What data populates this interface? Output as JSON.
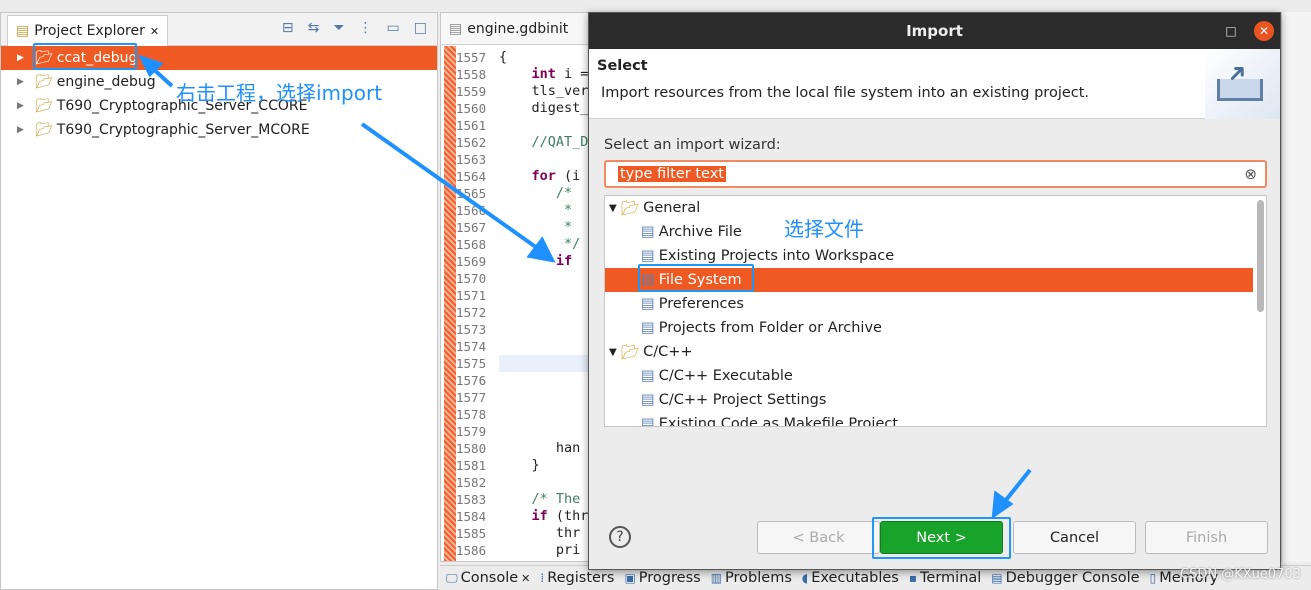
{
  "project_explorer": {
    "tab_label": "Project Explorer",
    "items": [
      {
        "label": "ccat_debug",
        "selected": true
      },
      {
        "label": "engine_debug"
      },
      {
        "label": "T690_Cryptographic_Server_CCORE"
      },
      {
        "label": "T690_Cryptographic_Server_MCORE"
      }
    ]
  },
  "editor": {
    "tab_label": "engine.gdbinit",
    "line_numbers": [
      "1557",
      "1558",
      "1559",
      "1560",
      "1561",
      "1562",
      "1563",
      "1564",
      "1565",
      "1566",
      "1567",
      "1568",
      "1569",
      "1570",
      "1571",
      "1572",
      "1573",
      "1574",
      "1575",
      "1576",
      "1577",
      "1578",
      "1579",
      "1580",
      "1581",
      "1582",
      "1583",
      "1584",
      "1585",
      "1586"
    ],
    "code": [
      "{",
      "    int i =",
      "    tls_ver",
      "    digest_",
      "",
      "    //QAT_D",
      "",
      "    for (i",
      "       /*",
      "        *",
      "        *",
      "        */",
      "       if",
      "",
      "",
      "",
      "",
      "",
      "",
      "",
      "",
      "",
      "",
      "       han",
      "    }",
      "",
      "    /* The",
      "    if (thr",
      "       thr",
      "       pri"
    ]
  },
  "bottom_tabs": [
    "Console",
    "Registers",
    "Progress",
    "Problems",
    "Executables",
    "Terminal",
    "Debugger Console",
    "Memory"
  ],
  "dialog": {
    "title": "Import",
    "header_title": "Select",
    "header_desc": "Import resources from the local file system into an existing project.",
    "wizard_label": "Select an import wizard:",
    "filter_value": "type filter text",
    "tree": [
      {
        "label": "General",
        "level": 0
      },
      {
        "label": "Archive File",
        "level": 1
      },
      {
        "label": "Existing Projects into Workspace",
        "level": 1
      },
      {
        "label": "File System",
        "level": 1,
        "selected": true
      },
      {
        "label": "Preferences",
        "level": 1
      },
      {
        "label": "Projects from Folder or Archive",
        "level": 1
      },
      {
        "label": "C/C++",
        "level": 0
      },
      {
        "label": "C/C++ Executable",
        "level": 1
      },
      {
        "label": "C/C++ Project Settings",
        "level": 1
      },
      {
        "label": "Existing Code as Makefile Project",
        "level": 1
      }
    ],
    "buttons": {
      "back": "< Back",
      "next": "Next >",
      "cancel": "Cancel",
      "finish": "Finish"
    }
  },
  "annotations": {
    "right_click": "右击工程，选择import",
    "select_file": "选择文件"
  },
  "watermark": "CSDN @KXue0703",
  "colors": {
    "selection": "#ef5a24",
    "annotation": "#1e90ff",
    "next_button": "#18a32a"
  }
}
